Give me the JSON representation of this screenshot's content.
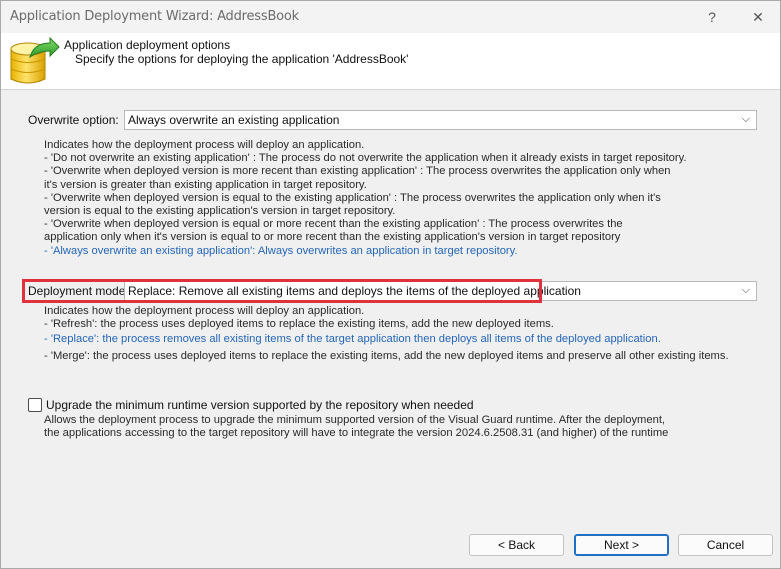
{
  "window": {
    "title": "Application Deployment Wizard: AddressBook",
    "help_glyph": "?",
    "close_glyph": "✕"
  },
  "header": {
    "title": "Application deployment options",
    "subtitle": "Specify the options for deploying the application 'AddressBook'",
    "icon": "database-deploy-icon"
  },
  "overwrite": {
    "label": "Overwrite option:",
    "value": "Always overwrite an existing application",
    "desc": [
      "Indicates how the deployment process will deploy an application.",
      "- 'Do not overwrite an existing application' : The process do not overwrite the application when it already exists in target repository.",
      "- 'Overwrite when deployed version is more recent than existing application' : The process overwrites the application only when",
      "it's version is greater than existing application in target repository.",
      "- 'Overwrite when deployed version is equal to the existing application' : The process overwrites the application only when it's",
      "version is equal to the existing application's version in target repository.",
      "- 'Overwrite when deployed version is equal or more recent than the existing application' : The process overwrites the",
      "application only when it's version is equal to or more recent than the existing application's version in target repository"
    ],
    "selected_desc": "- 'Always overwrite an existing application': Always overwrites an application in target repository."
  },
  "deployment": {
    "label": "Deployment mode:",
    "value": "Replace: Remove all existing items and deploys the items of the deployed application",
    "desc_intro": "Indicates how the deployment process will deploy an application.",
    "desc_refresh": "- 'Refresh': the process uses deployed items to replace the existing items, add the new deployed items.",
    "desc_replace": "- 'Replace': the process removes all existing items of the target application then deploys all items of the deployed application.",
    "desc_merge": "- 'Merge': the process uses deployed items to replace the existing items, add the new deployed items and preserve all other existing items."
  },
  "upgrade": {
    "label": "Upgrade the minimum runtime version supported by the repository when needed",
    "checked": false,
    "desc": [
      "Allows the deployment process to upgrade the minimum supported version of the Visual Guard runtime. After the deployment,",
      "the applications accessing to the target repository will have to integrate the version 2024.6.2508.31 (and higher) of the runtime"
    ]
  },
  "buttons": {
    "back": "< Back",
    "next": "Next >",
    "cancel": "Cancel"
  },
  "colors": {
    "highlight": "#e0323d",
    "selected_text": "#2566b8",
    "primary_border": "#1f6fc4"
  }
}
